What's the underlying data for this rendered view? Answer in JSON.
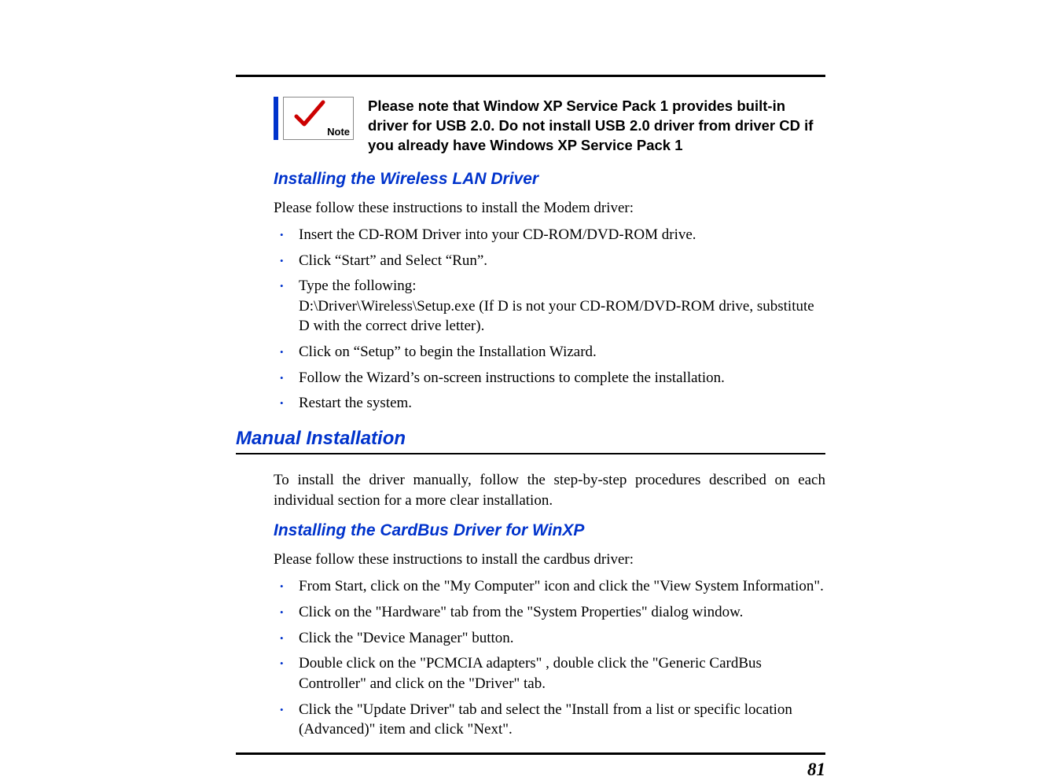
{
  "note": {
    "icon_label": "Note",
    "text": "Please note that Window XP Service Pack 1 provides built-in driver for USB 2.0.  Do not install USB 2.0 driver from driver CD if you already have Windows XP Service Pack 1"
  },
  "section_wlan": {
    "heading": "Installing the Wireless LAN Driver",
    "intro": "Please follow these instructions to install the Modem driver:",
    "items": [
      {
        "text": "Insert the CD-ROM Driver into your CD-ROM/DVD-ROM drive."
      },
      {
        "text": "Click “Start” and Select “Run”."
      },
      {
        "text": "Type the following:",
        "sub": "D:\\Driver\\Wireless\\Setup.exe (If D is not your CD-ROM/DVD-ROM drive, substitute D with the correct drive letter)."
      },
      {
        "text": "Click on “Setup” to begin the Installation Wizard."
      },
      {
        "text": "Follow the Wizard’s on-screen instructions to complete the installation."
      },
      {
        "text": "Restart the system."
      }
    ]
  },
  "section_manual": {
    "heading": "Manual Installation",
    "intro": "To install the driver manually, follow the step-by-step procedures described on each individual section for a more clear installation."
  },
  "section_cardbus": {
    "heading": "Installing the CardBus Driver for WinXP",
    "intro": "Please follow these instructions to install the cardbus driver:",
    "items": [
      {
        "text": "From Start, click on the \"My Computer\" icon and click the \"View System Information\"."
      },
      {
        "text": "Click on the \"Hardware\" tab from the \"System Properties\" dialog window."
      },
      {
        "text": "Click the \"Device Manager\" button."
      },
      {
        "text": "Double click on the \"PCMCIA adapters\" , double click the \"Generic CardBus Controller\" and click on the \"Driver\" tab."
      },
      {
        "text": "Click the \"Update Driver\" tab and select the \"Install from a list or specific location (Advanced)\" item and click \"Next\"."
      }
    ]
  },
  "page_number": "81"
}
